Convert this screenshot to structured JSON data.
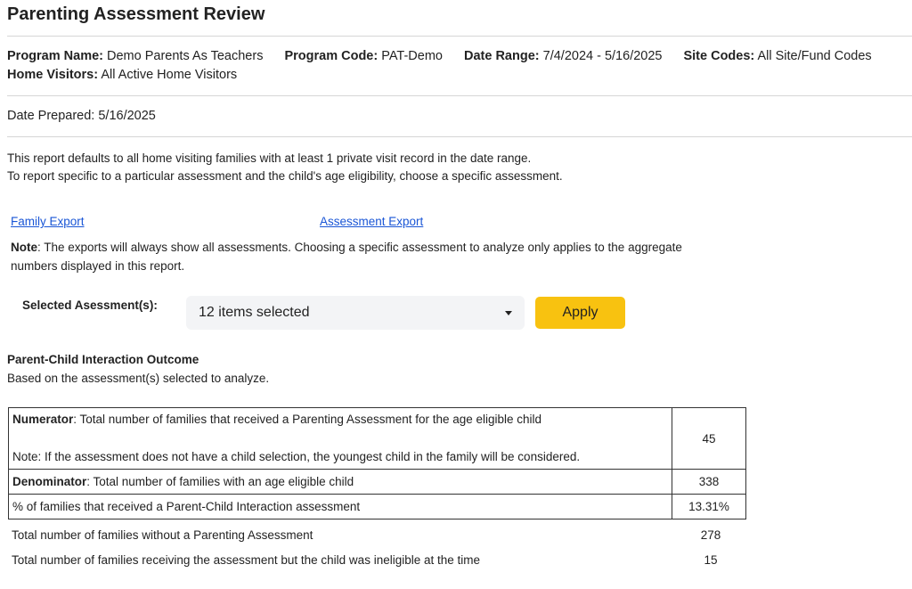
{
  "header": {
    "title": "Parenting Assessment Review"
  },
  "meta": {
    "program_name_label": "Program Name:",
    "program_name": "Demo Parents As Teachers",
    "program_code_label": "Program Code:",
    "program_code": "PAT-Demo",
    "date_range_label": "Date Range:",
    "date_range": "7/4/2024 - 5/16/2025",
    "site_codes_label": "Site Codes:",
    "site_codes": "All Site/Fund Codes",
    "home_visitors_label": "Home Visitors:",
    "home_visitors": "All Active Home Visitors",
    "date_prepared": "Date Prepared: 5/16/2025"
  },
  "intro": {
    "line1": "This report defaults to all home visiting families with at least 1 private visit record in the date range.",
    "line2": "To report specific to a particular assessment and the child's age eligibility, choose a specific assessment."
  },
  "links": {
    "family_export": "Family Export",
    "assessment_export": "Assessment Export"
  },
  "note": {
    "label": "Note",
    "text": ": The exports will always show all assessments. Choosing a specific assessment to analyze only applies to the aggregate numbers displayed in this report."
  },
  "selector": {
    "label": "Selected Asessment(s):",
    "value": "12 items selected",
    "apply_label": "Apply"
  },
  "outcome": {
    "title": "Parent-Child Interaction Outcome",
    "subtitle": "Based on the assessment(s) selected to analyze.",
    "numerator_label": "Numerator",
    "numerator_text": ": Total number of families that received a Parenting Assessment for the age eligible child",
    "numerator_note": "Note: If the assessment does not have a child selection, the youngest child in the family will be considered.",
    "numerator_value": "45",
    "denominator_label": "Denominator",
    "denominator_text": ": Total number of families with an age eligible child",
    "denominator_value": "338",
    "percent_label": "% of families that received a Parent-Child Interaction assessment",
    "percent_value": "13.31%",
    "without_label": "Total number of families without a Parenting Assessment",
    "without_value": "278",
    "ineligible_label": "Total number of families receiving the assessment but the child was ineligible at the time",
    "ineligible_value": "15"
  }
}
